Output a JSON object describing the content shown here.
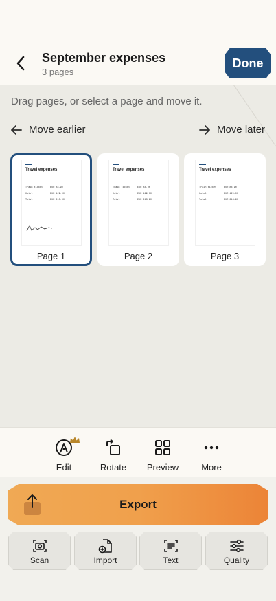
{
  "header": {
    "title": "September expenses",
    "subtitle": "3 pages",
    "done_label": "Done"
  },
  "workspace": {
    "hint": "Drag pages, or select a page and move it.",
    "move_earlier": "Move earlier",
    "move_later": "Move later"
  },
  "pages": [
    {
      "label": "Page 1",
      "selected": true
    },
    {
      "label": "Page 2",
      "selected": false
    },
    {
      "label": "Page 3",
      "selected": false
    }
  ],
  "document": {
    "title": "Travel expenses",
    "rows": [
      {
        "item": "Train ticket",
        "amount": "EUR 84.90"
      },
      {
        "item": "Hotel",
        "amount": "EUR 129.00"
      },
      {
        "item": "Total",
        "amount": "EUR 213.90"
      }
    ]
  },
  "toolbar": {
    "edit": "Edit",
    "rotate": "Rotate",
    "preview": "Preview",
    "more": "More"
  },
  "export_label": "Export",
  "actions": {
    "scan": "Scan",
    "import": "Import",
    "text": "Text",
    "quality": "Quality"
  },
  "colors": {
    "accent": "#234f7d",
    "export_gradient_start": "#f0a954",
    "export_gradient_end": "#ec8437",
    "crown": "#b8862a"
  },
  "icons": {
    "back": "chevron-left-icon",
    "edit": "pen-nib-icon",
    "rotate": "rotate-icon",
    "preview": "grid-icon",
    "more": "ellipsis-icon",
    "export": "share-icon",
    "scan": "camera-icon",
    "import": "file-plus-icon",
    "text": "text-scan-icon",
    "quality": "sliders-icon"
  }
}
